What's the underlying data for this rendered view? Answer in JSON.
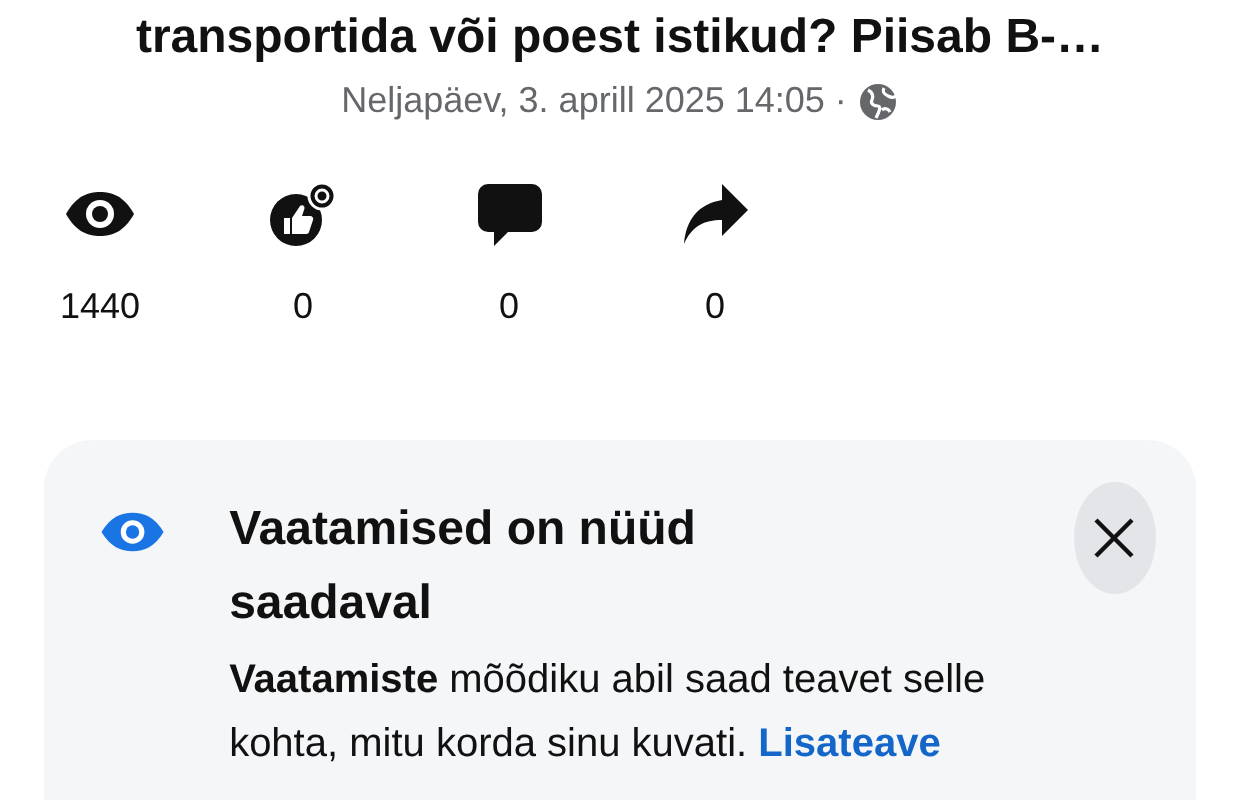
{
  "post": {
    "title": "transportida või poest istikud? Piisab B-…",
    "date": "Neljapäev, 3. aprill 2025 14:05 ·"
  },
  "stats": [
    {
      "kind": "views",
      "count": "1440"
    },
    {
      "kind": "reactions",
      "count": "0"
    },
    {
      "kind": "comments",
      "count": "0"
    },
    {
      "kind": "shares",
      "count": "0"
    }
  ],
  "notice": {
    "title": "Vaatamised on nüüd saadaval",
    "body": "**Vaatamiste** mõõdiku abil saad teavet selle kohta, mitu korda sinu kuvati.",
    "link": "Lisateave"
  }
}
